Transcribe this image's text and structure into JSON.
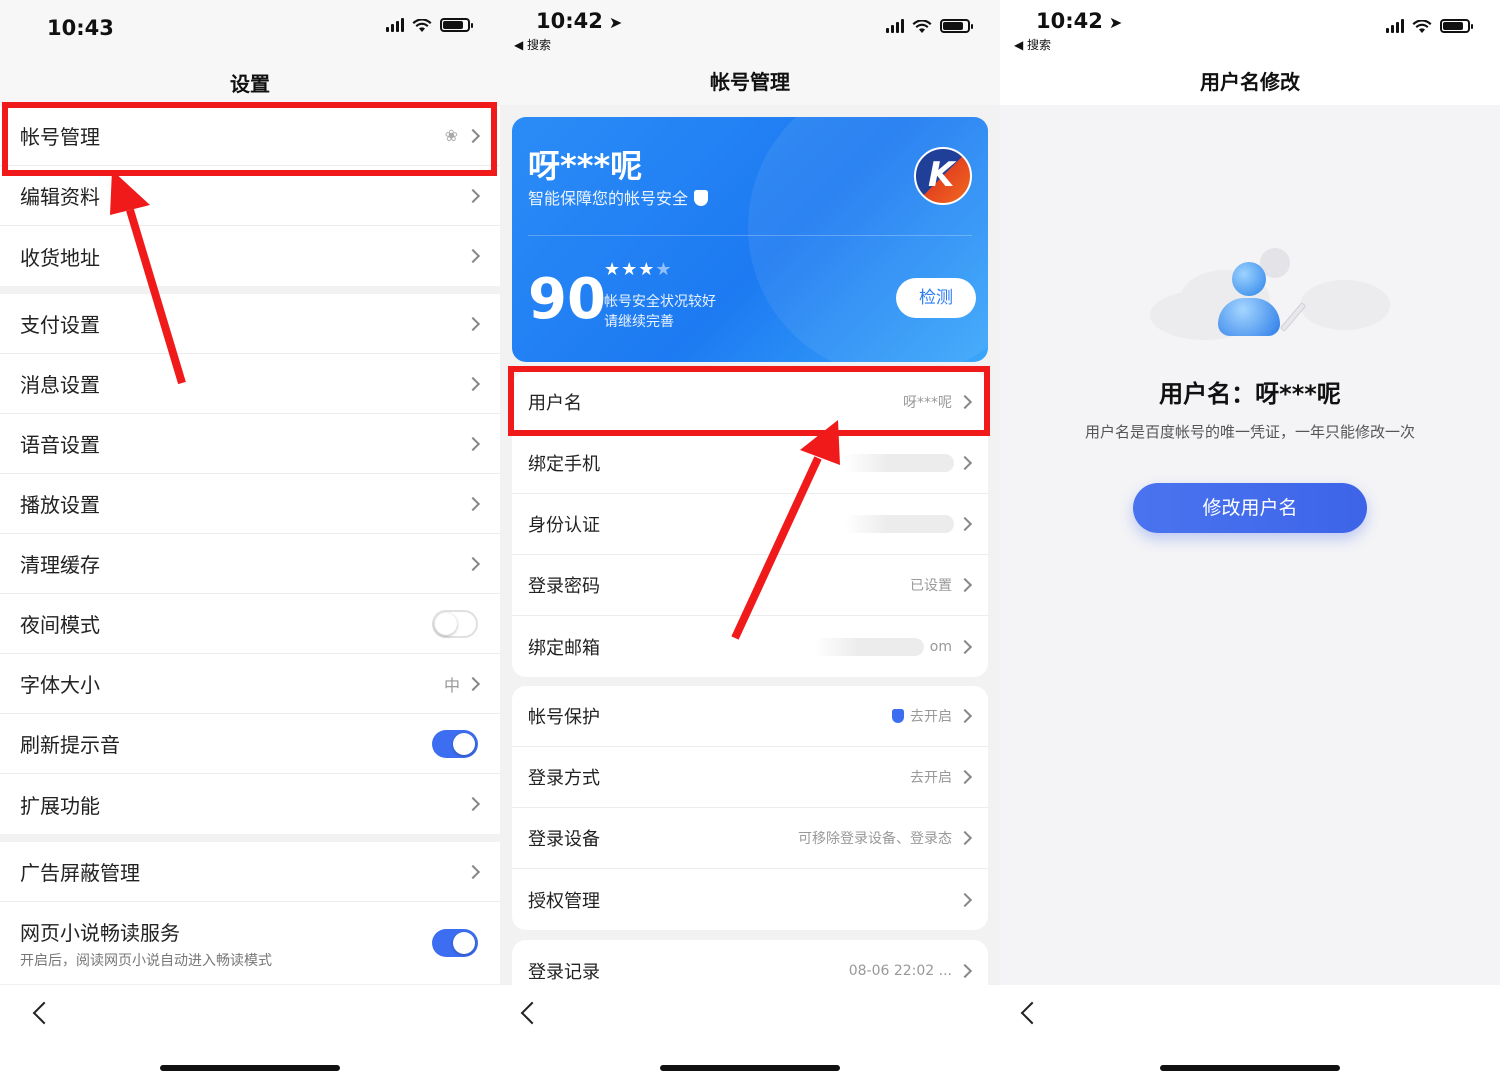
{
  "panels": [
    {
      "status": {
        "time": "10:43"
      },
      "title": "设置"
    },
    {
      "status": {
        "time": "10:42",
        "back": "◀ 搜索"
      },
      "title": "帐号管理"
    },
    {
      "status": {
        "time": "10:42",
        "back": "◀ 搜索"
      },
      "title": "用户名修改"
    }
  ],
  "settings": {
    "groups": [
      [
        {
          "label": "帐号管理",
          "type": "chevron"
        },
        {
          "label": "编辑资料",
          "type": "chevron"
        },
        {
          "label": "收货地址",
          "type": "chevron"
        }
      ],
      [
        {
          "label": "支付设置",
          "type": "chevron"
        },
        {
          "label": "消息设置",
          "type": "chevron"
        },
        {
          "label": "语音设置",
          "type": "chevron"
        },
        {
          "label": "播放设置",
          "type": "chevron"
        },
        {
          "label": "清理缓存",
          "type": "chevron"
        },
        {
          "label": "夜间模式",
          "type": "toggle",
          "on": false
        },
        {
          "label": "字体大小",
          "type": "chevron",
          "value": "中"
        },
        {
          "label": "刷新提示音",
          "type": "toggle",
          "on": true
        },
        {
          "label": "扩展功能",
          "type": "chevron"
        }
      ],
      [
        {
          "label": "广告屏蔽管理",
          "type": "chevron"
        },
        {
          "label": "网页小说畅读服务",
          "type": "toggle",
          "on": true,
          "sub": "开启后，阅读网页小说自动进入畅读模式"
        }
      ]
    ]
  },
  "account": {
    "name": "呀***呢",
    "subtitle": "智能保障您的帐号安全",
    "avatar_letter": "K",
    "score": "90",
    "stars_filled": 3,
    "stars_total": 4,
    "status_line1": "帐号安全状况较好",
    "status_line2": "请继续完善",
    "check_button": "检测",
    "list1": [
      {
        "label": "用户名",
        "value": "呀***呢"
      },
      {
        "label": "绑定手机",
        "value": "",
        "blurred": true
      },
      {
        "label": "身份认证",
        "value": "",
        "blurred": true
      },
      {
        "label": "登录密码",
        "value": "已设置"
      },
      {
        "label": "绑定邮箱",
        "value": "om",
        "blurred": true
      }
    ],
    "list2": [
      {
        "label": "帐号保护",
        "value": "去开启",
        "shield": true
      },
      {
        "label": "登录方式",
        "value": "去开启"
      },
      {
        "label": "登录设备",
        "value": "可移除登录设备、登录态"
      },
      {
        "label": "授权管理",
        "value": ""
      }
    ],
    "list3": [
      {
        "label": "登录记录",
        "value": "08-06 22:02 ..."
      }
    ]
  },
  "username": {
    "title": "用户名：呀***呢",
    "description": "用户名是百度帐号的唯一凭证，一年只能修改一次",
    "button": "修改用户名"
  },
  "colors": {
    "highlight": "#f01a1a",
    "accent": "#3d6ef2",
    "card_blue": "#1d7af2"
  }
}
